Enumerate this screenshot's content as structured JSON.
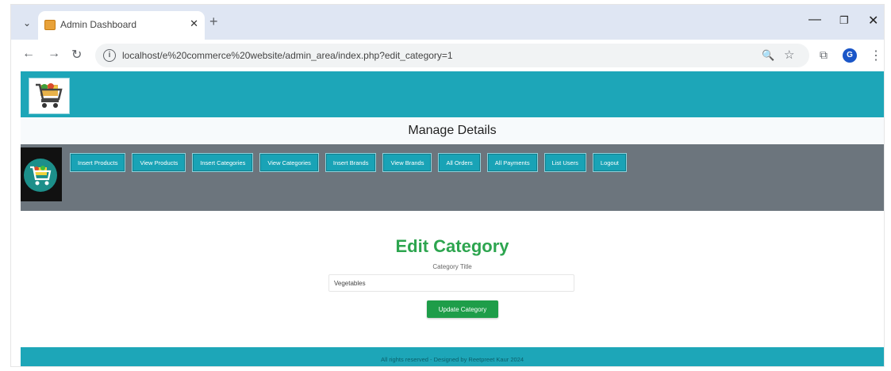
{
  "browser": {
    "tab_title": "Admin Dashboard",
    "new_tab_symbol": "+",
    "url": "localhost/e%20commerce%20website/admin_area/index.php?edit_category=1",
    "profile_initial": "G"
  },
  "page": {
    "manage_title": "Manage Details",
    "nav_buttons": [
      "Insert Products",
      "View Products",
      "Insert Categories",
      "View Categories",
      "Insert Brands",
      "View Brands",
      "All Orders",
      "All Payments",
      "List Users",
      "Logout"
    ],
    "form": {
      "heading": "Edit Category",
      "field_label": "Category Title",
      "category_value": "Vegetables",
      "submit_label": "Update Category"
    },
    "footer_text": "All rights reserved - Designed by Reetpreet Kaur 2024"
  },
  "colors": {
    "header_teal": "#1da6b8",
    "nav_gray": "#6c757d",
    "heading_green": "#2da54f",
    "button_green": "#1e9d49"
  },
  "icons": {
    "logo": "shopping-cart-icon",
    "avatar": "shopping-cart-icon"
  }
}
